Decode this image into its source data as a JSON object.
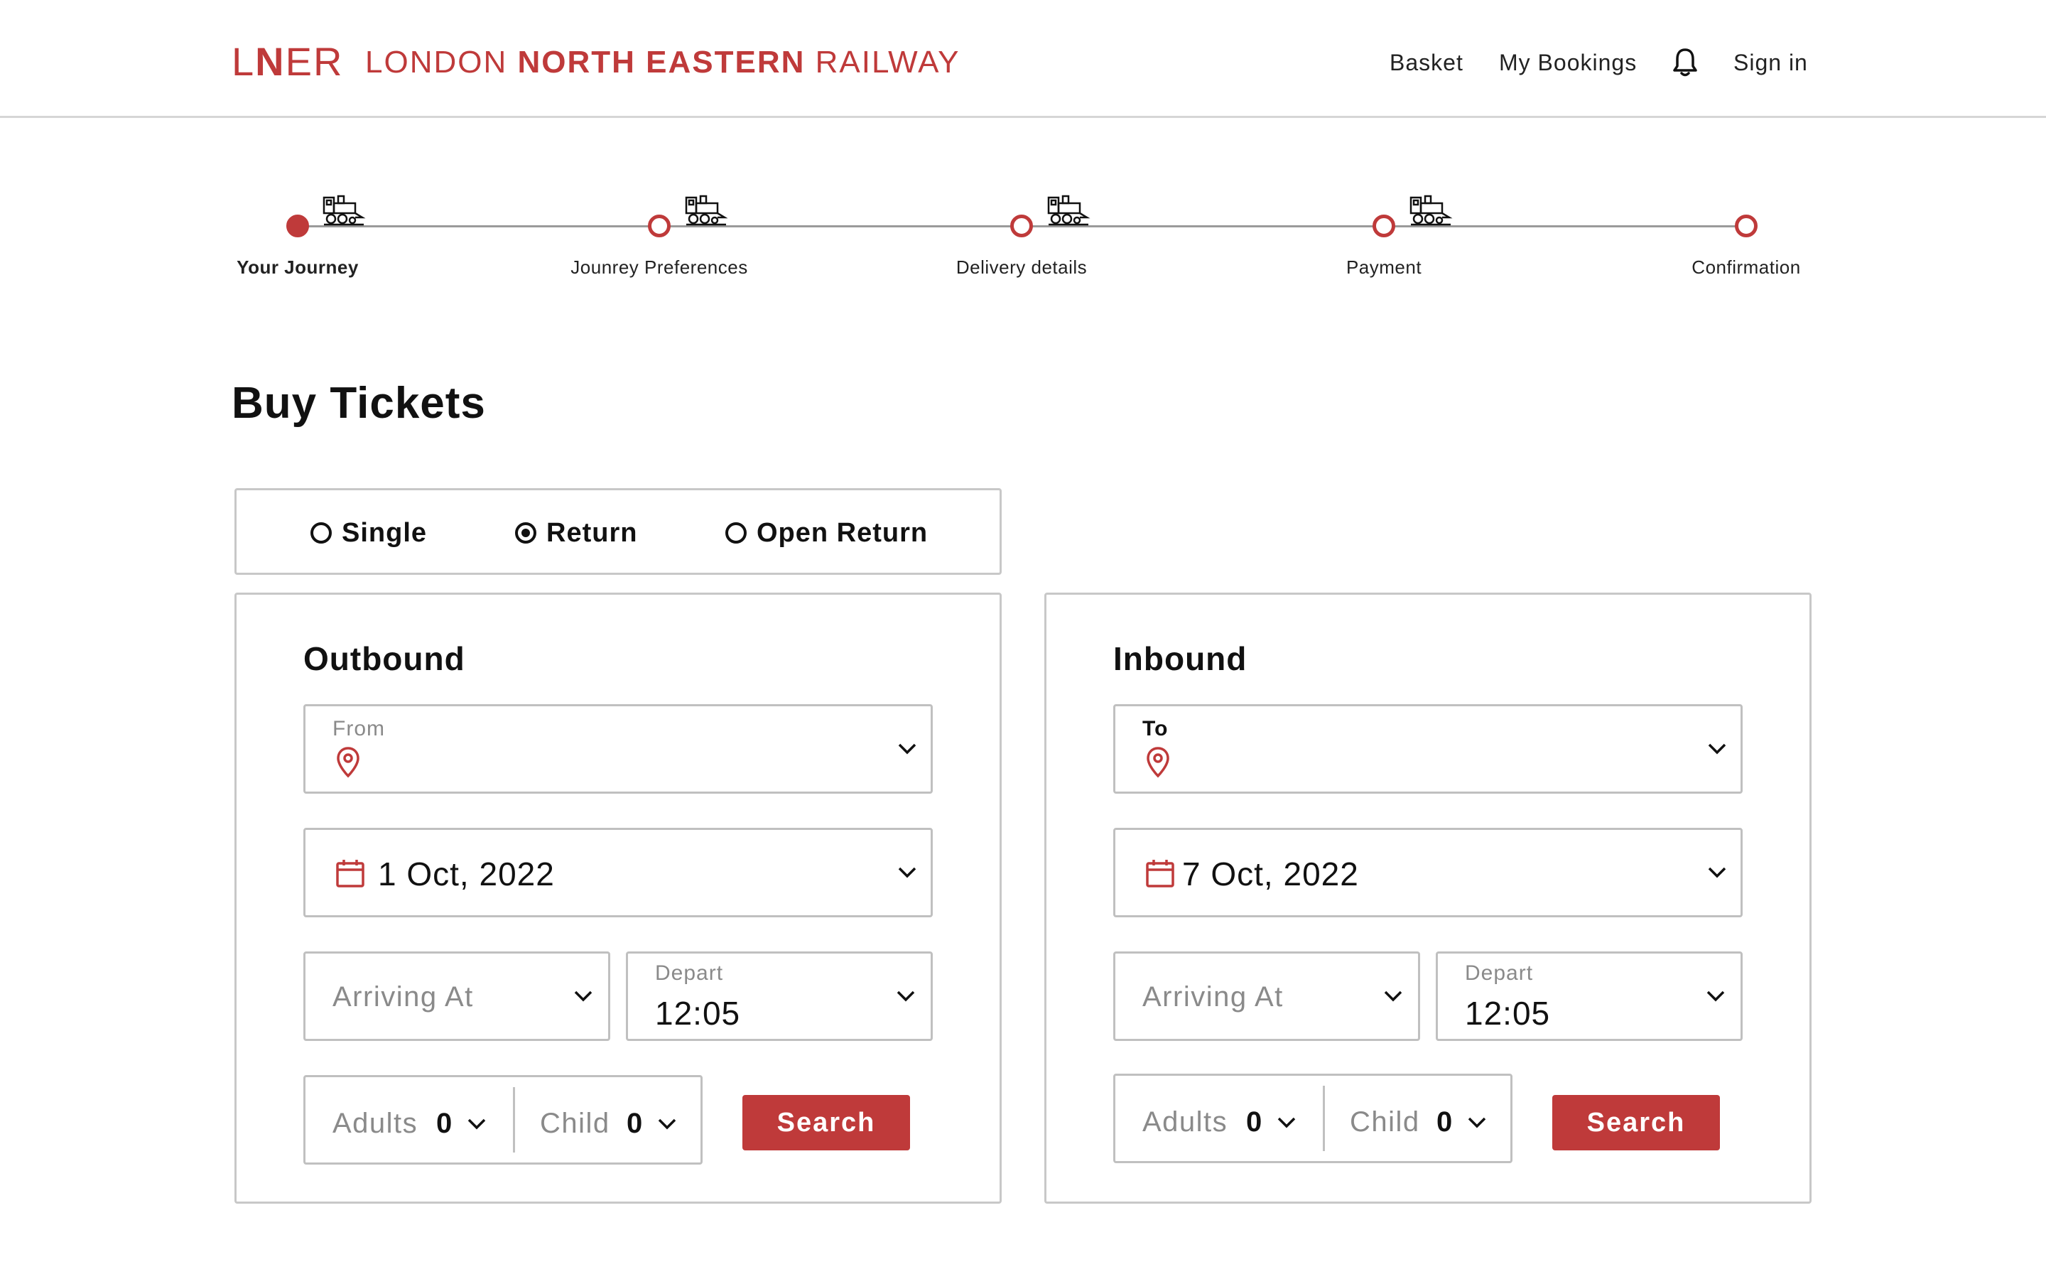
{
  "brand": {
    "mark_prefix": "L",
    "mark_n": "N",
    "mark_suffix": "ER",
    "name_part1": "LONDON ",
    "name_part2": "NORTH EASTERN",
    "name_part3": " RAILWAY",
    "color": "#bf3a3a"
  },
  "nav": {
    "basket": "Basket",
    "bookings": "My Bookings",
    "notifications_icon": "bell-icon",
    "sign_in": "Sign in"
  },
  "progress": {
    "steps": [
      {
        "label": "Your Journey",
        "active": true
      },
      {
        "label": "Jounrey Preferences",
        "active": false
      },
      {
        "label": "Delivery details",
        "active": false
      },
      {
        "label": "Payment",
        "active": false
      },
      {
        "label": "Confirmation",
        "active": false
      }
    ]
  },
  "page_title": "Buy Tickets",
  "trip_type": {
    "options": [
      "Single",
      "Return",
      "Open Return"
    ],
    "selected": "Return"
  },
  "outbound": {
    "title": "Outbound",
    "from_label": "From",
    "from_value": "",
    "date": "1 Oct, 2022",
    "arriving_placeholder": "Arriving At",
    "depart_label": "Depart",
    "depart_time": "12:05",
    "adults_label": "Adults",
    "adults_count": "0",
    "child_label": "Child",
    "child_count": "0",
    "search_label": "Search"
  },
  "inbound": {
    "title": "Inbound",
    "to_label": "To",
    "to_value": "",
    "date": "7 Oct, 2022",
    "arriving_placeholder": "Arriving At",
    "depart_label": "Depart",
    "depart_time": "12:05",
    "adults_label": "Adults",
    "adults_count": "0",
    "child_label": "Child",
    "child_count": "0",
    "search_label": "Search"
  },
  "colors": {
    "accent": "#bf3a3a",
    "border": "#c8c8c8",
    "muted_text": "#8a8a8a"
  }
}
